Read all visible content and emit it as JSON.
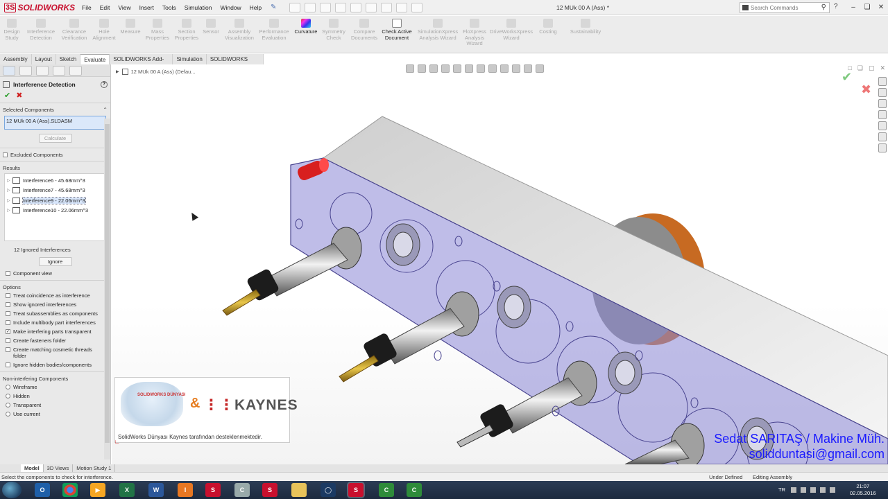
{
  "app": {
    "logo_text": "SOLIDWORKS",
    "logo_prefix": "3S",
    "window_title": "12 MUk 00 A (Ass) *",
    "menu": [
      "File",
      "Edit",
      "View",
      "Insert",
      "Tools",
      "Simulation",
      "Window",
      "Help"
    ],
    "search_placeholder": "Search Commands"
  },
  "commands": [
    {
      "label": "Design\nStudy",
      "state": "disabled"
    },
    {
      "label": "Interference\nDetection",
      "state": "disabled"
    },
    {
      "label": "Clearance\nVerification",
      "state": "disabled"
    },
    {
      "label": "Hole\nAlignment",
      "state": "disabled"
    },
    {
      "label": "Measure",
      "state": "disabled"
    },
    {
      "label": "Mass\nProperties",
      "state": "disabled"
    },
    {
      "label": "Section\nProperties",
      "state": "disabled"
    },
    {
      "label": "Sensor",
      "state": "disabled"
    },
    {
      "label": "Assembly\nVisualization",
      "state": "disabled"
    },
    {
      "label": "Performance\nEvaluation",
      "state": "disabled"
    },
    {
      "label": "Curvature",
      "state": "active"
    },
    {
      "label": "Symmetry\nCheck",
      "state": "disabled"
    },
    {
      "label": "Compare\nDocuments",
      "state": "disabled"
    },
    {
      "label": "Check Active\nDocument",
      "state": "active"
    },
    {
      "label": "SimulationXpress\nAnalysis Wizard",
      "state": "disabled"
    },
    {
      "label": "FloXpress\nAnalysis\nWizard",
      "state": "disabled"
    },
    {
      "label": "DriveWorksXpress\nWizard",
      "state": "disabled"
    },
    {
      "label": "Costing",
      "state": "disabled"
    },
    {
      "label": "Sustainability",
      "state": "disabled"
    }
  ],
  "tabs": [
    "Assembly",
    "Layout",
    "Sketch",
    "Evaluate",
    "SOLIDWORKS Add-Ins",
    "Simulation",
    "SOLIDWORKS MBD"
  ],
  "active_tab": "Evaluate",
  "panel": {
    "title": "Interference Detection",
    "help": "?",
    "selected_components_label": "Selected Components",
    "selected_value": "12 MUk 00 A (Ass).SLDASM",
    "calculate_label": "Calculate",
    "excluded_label": "Excluded Components",
    "results_label": "Results",
    "results": [
      {
        "label": "Interference6 - 45.68mm^3",
        "selected": false
      },
      {
        "label": "Interference7 - 45.68mm^3",
        "selected": false
      },
      {
        "label": "Interference9 - 22.06mm^3",
        "selected": true
      },
      {
        "label": "Interference10 - 22.06mm^3",
        "selected": false
      }
    ],
    "ignored_count": "12 Ignored Interferences",
    "ignore_label": "Ignore",
    "component_view_label": "Component view",
    "options_label": "Options",
    "options": [
      {
        "label": "Treat coincidence as interference",
        "checked": false
      },
      {
        "label": "Show ignored interferences",
        "checked": false
      },
      {
        "label": "Treat subassemblies as components",
        "checked": false
      },
      {
        "label": "Include multibody part interferences",
        "checked": false
      },
      {
        "label": "Make interfering parts transparent",
        "checked": true
      },
      {
        "label": "Create fasteners folder",
        "checked": false
      },
      {
        "label": "Create matching cosmetic threads folder",
        "checked": false
      },
      {
        "label": "Ignore hidden bodies/components",
        "checked": false
      }
    ],
    "non_interfering_label": "Non-interfering Components",
    "non_interfering": [
      "Wireframe",
      "Hidden",
      "Transparent",
      "Use current"
    ]
  },
  "viewport": {
    "tree_label": "12 MUk 00 A (Ass)  (Defau...",
    "sponsor_text": "SolidWorks Dünyası Kaynes tarafından desteklenmektedir.",
    "sponsor_brand": "KAYNES",
    "sponsor_logo_text": "SOLIDWORKS DÜNYASI",
    "author_line1": "Sedat SARITAŞ / Makine Müh.",
    "author_line2": "solidduntasi@gmail.com"
  },
  "bottom_tabs": [
    "Model",
    "3D Views",
    "Motion Study 1"
  ],
  "status": {
    "message": "Select the components to check for interference.",
    "state1": "Under Defined",
    "state2": "Editing Assembly"
  },
  "taskbar": {
    "apps": [
      "Outlook",
      "Chrome",
      "Media",
      "Excel",
      "Word",
      "Inspiron",
      "SolidWorks",
      "Composer",
      "SW2016",
      "Explorer",
      "Steam",
      "SW2016b",
      "Camtasia",
      "Camtasia2"
    ],
    "language": "TR",
    "time": "21:07",
    "date": "02.05.2016"
  },
  "colors": {
    "accent_red": "#c8102e",
    "selection_blue": "#dbe8fa",
    "author_blue": "#1a1aff",
    "transparent_body": "#8a86d6"
  }
}
